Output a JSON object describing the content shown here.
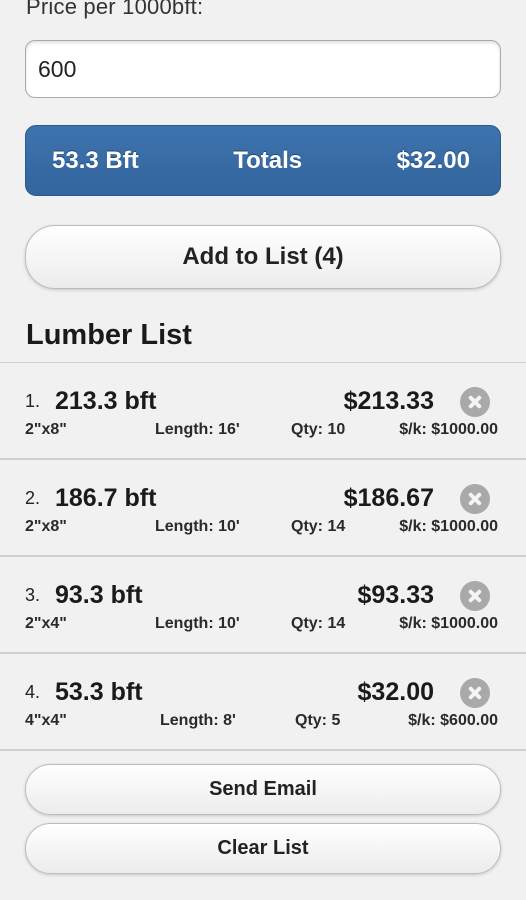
{
  "price": {
    "label": "Price per 1000bft:",
    "value": "600"
  },
  "totals": {
    "bft": "53.3 Bft",
    "label": "Totals",
    "cost": "$32.00",
    "bar_color": "#3a6ca5"
  },
  "add_button_label": "Add to List (4)",
  "lumber_list": {
    "title": "Lumber List",
    "items": [
      {
        "num": "1.",
        "bft": "213.3 bft",
        "cost": "$213.33",
        "size": "2\"x8\"",
        "length": "Length: 16'",
        "qty": "Qty: 10",
        "rate": "$/k: $1000.00"
      },
      {
        "num": "2.",
        "bft": "186.7 bft",
        "cost": "$186.67",
        "size": "2\"x8\"",
        "length": "Length: 10'",
        "qty": "Qty: 14",
        "rate": "$/k: $1000.00"
      },
      {
        "num": "3.",
        "bft": "93.3 bft",
        "cost": "$93.33",
        "size": "2\"x4\"",
        "length": "Length: 10'",
        "qty": "Qty: 14",
        "rate": "$/k: $1000.00"
      },
      {
        "num": "4.",
        "bft": "53.3 bft",
        "cost": "$32.00",
        "size": "4\"x4\"",
        "length": "Length: 8'",
        "qty": "Qty: 5",
        "rate": "$/k: $600.00"
      }
    ]
  },
  "actions": {
    "send_email": "Send Email",
    "clear_list": "Clear List"
  }
}
